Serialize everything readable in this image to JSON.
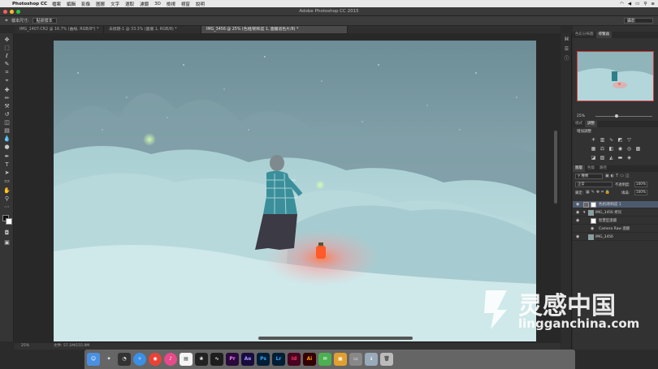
{
  "menubar": {
    "app_name": "Photoshop CC",
    "items": [
      "檔案",
      "編輯",
      "影像",
      "圖層",
      "文字",
      "選取",
      "濾鏡",
      "3D",
      "檢視",
      "視窗",
      "說明"
    ]
  },
  "window": {
    "title": "Adobe Photoshop CC 2015"
  },
  "options": {
    "style_label": "樣本尺寸:",
    "style_value": "點狀樣本",
    "workspace": "攝影"
  },
  "tabs": [
    "IMG_1407.CR2 @ 16.7% (曲線, RGB/8*) *",
    "未標題-1 @ 33.3% (圖層 1, RGB/8) *",
    "IMG_3456 @ 25% (色相/飽和度 1, 圖層遮色片/8) *"
  ],
  "panels": {
    "navigator_tabs": [
      "色彩分佈圖",
      "導覽器"
    ],
    "zoom_value": "25%",
    "adjustments_tabs": [
      "樣式",
      "調整"
    ],
    "adjustments_title": "增加調整",
    "layers_tabs": [
      "圖層",
      "色版",
      "路徑"
    ],
    "kind_filter": "種類",
    "blend_mode": "正常",
    "opacity_label": "不透明度:",
    "opacity_value": "100%",
    "lock_label": "鎖定:",
    "fill_label": "填滿:",
    "fill_value": "100%",
    "layers": [
      "色相/飽和度 1",
      "IMG_3456 拷貝",
      "智慧型濾鏡",
      "Camera Raw 濾鏡",
      "IMG_3456"
    ]
  },
  "status": {
    "zoom": "25%",
    "doc_label": "文件: 57.1M/155.9M"
  },
  "dock_apps": [
    "Finder",
    "Launchpad",
    "Dashboard",
    "Safari",
    "Chrome",
    "iTunes",
    "Notes",
    "Photos",
    "Activity",
    "Pr",
    "Ae",
    "Ps",
    "Lr",
    "Id",
    "Ai",
    "Trash"
  ],
  "watermark": {
    "cn": "灵感中国",
    "en": "lingganchina.com"
  },
  "colors": {
    "accent_red": "#d04040",
    "ps_blue": "#31a8ff"
  }
}
